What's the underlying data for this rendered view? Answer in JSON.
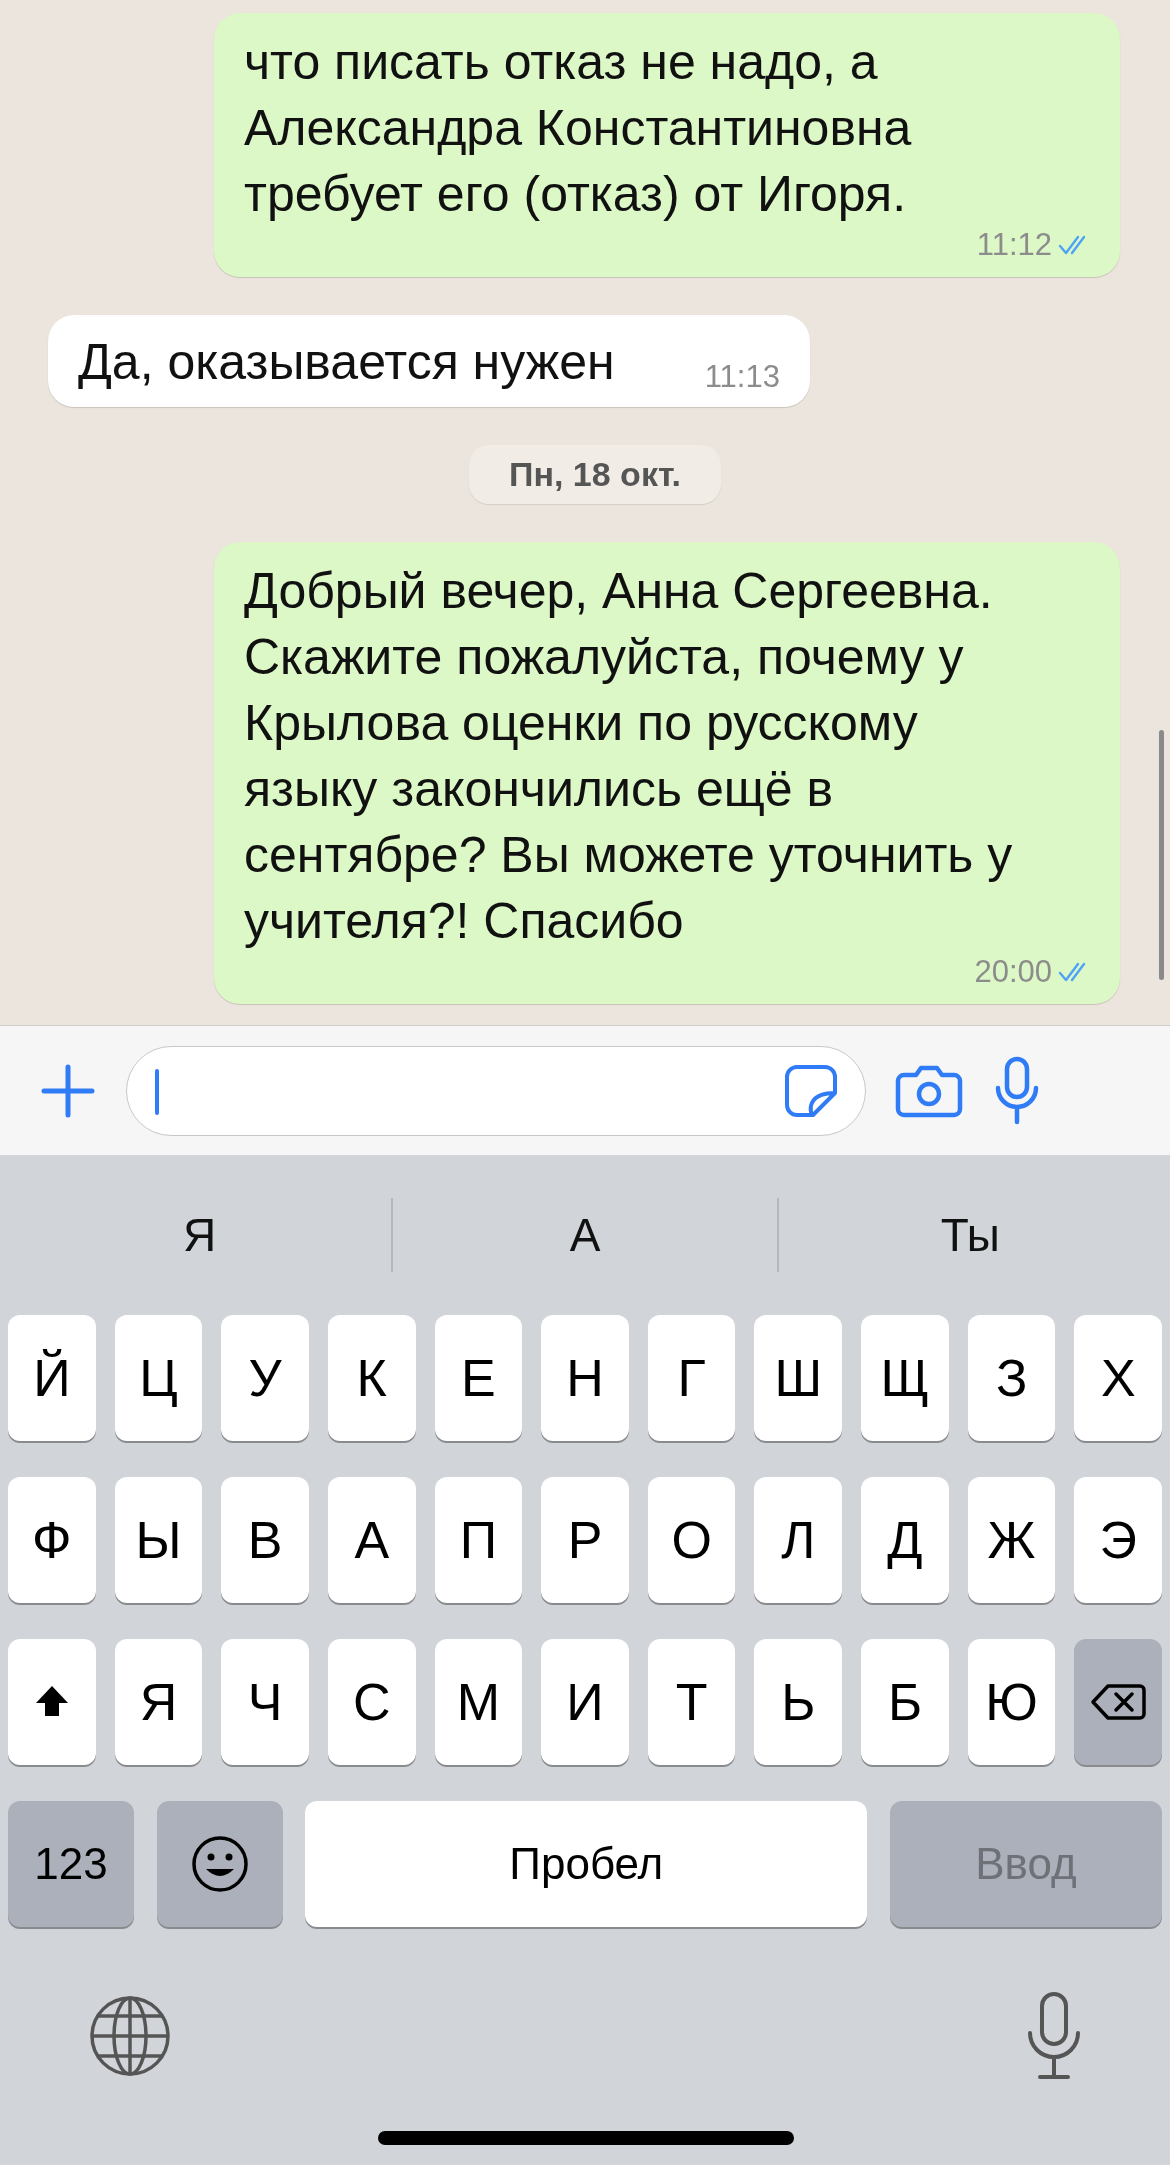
{
  "messages": [
    {
      "kind": "sent",
      "text": "что писать отказ не надо, а Александра Константиновна требует его (отказ) от Игоря.",
      "time": "11:12",
      "read": true
    },
    {
      "kind": "received",
      "text": "Да, оказывается нужен",
      "time": "11:13"
    },
    {
      "kind": "date",
      "text": "Пн, 18 окт."
    },
    {
      "kind": "sent",
      "text": "Добрый вечер, Анна Сергеевна. Скажите пожалуйста, почему у Крылова оценки по русскому языку закончились ещё в сентябре? Вы можете уточнить у учителя?! Спасибо",
      "time": "20:00",
      "read": true
    }
  ],
  "suggestions": [
    "Я",
    "А",
    "Ты"
  ],
  "keyboard": {
    "letter_rows": [
      {
        "keys": [
          {
            "kind": "letter",
            "label": "Й"
          },
          {
            "kind": "letter",
            "label": "Ц"
          },
          {
            "kind": "letter",
            "label": "У"
          },
          {
            "kind": "letter",
            "label": "К"
          },
          {
            "kind": "letter",
            "label": "Е"
          },
          {
            "kind": "letter",
            "label": "Н"
          },
          {
            "kind": "letter",
            "label": "Г"
          },
          {
            "kind": "letter",
            "label": "Ш"
          },
          {
            "kind": "letter",
            "label": "Щ"
          },
          {
            "kind": "letter",
            "label": "З"
          },
          {
            "kind": "letter",
            "label": "Х"
          }
        ]
      },
      {
        "keys": [
          {
            "kind": "letter",
            "label": "Ф"
          },
          {
            "kind": "letter",
            "label": "Ы"
          },
          {
            "kind": "letter",
            "label": "В"
          },
          {
            "kind": "letter",
            "label": "А"
          },
          {
            "kind": "letter",
            "label": "П"
          },
          {
            "kind": "letter",
            "label": "Р"
          },
          {
            "kind": "letter",
            "label": "О"
          },
          {
            "kind": "letter",
            "label": "Л"
          },
          {
            "kind": "letter",
            "label": "Д"
          },
          {
            "kind": "letter",
            "label": "Ж"
          },
          {
            "kind": "letter",
            "label": "Э"
          }
        ]
      },
      {
        "keys": [
          {
            "kind": "shift"
          },
          {
            "kind": "letter",
            "label": "Я"
          },
          {
            "kind": "letter",
            "label": "Ч"
          },
          {
            "kind": "letter",
            "label": "С"
          },
          {
            "kind": "letter",
            "label": "М"
          },
          {
            "kind": "letter",
            "label": "И"
          },
          {
            "kind": "letter",
            "label": "Т"
          },
          {
            "kind": "letter",
            "label": "Ь"
          },
          {
            "kind": "letter",
            "label": "Б"
          },
          {
            "kind": "letter",
            "label": "Ю"
          },
          {
            "kind": "backspace"
          }
        ]
      }
    ],
    "numbers_key": "123",
    "space_key": "Пробел",
    "return_key": {
      "label": "Ввод",
      "disabled": true
    }
  }
}
